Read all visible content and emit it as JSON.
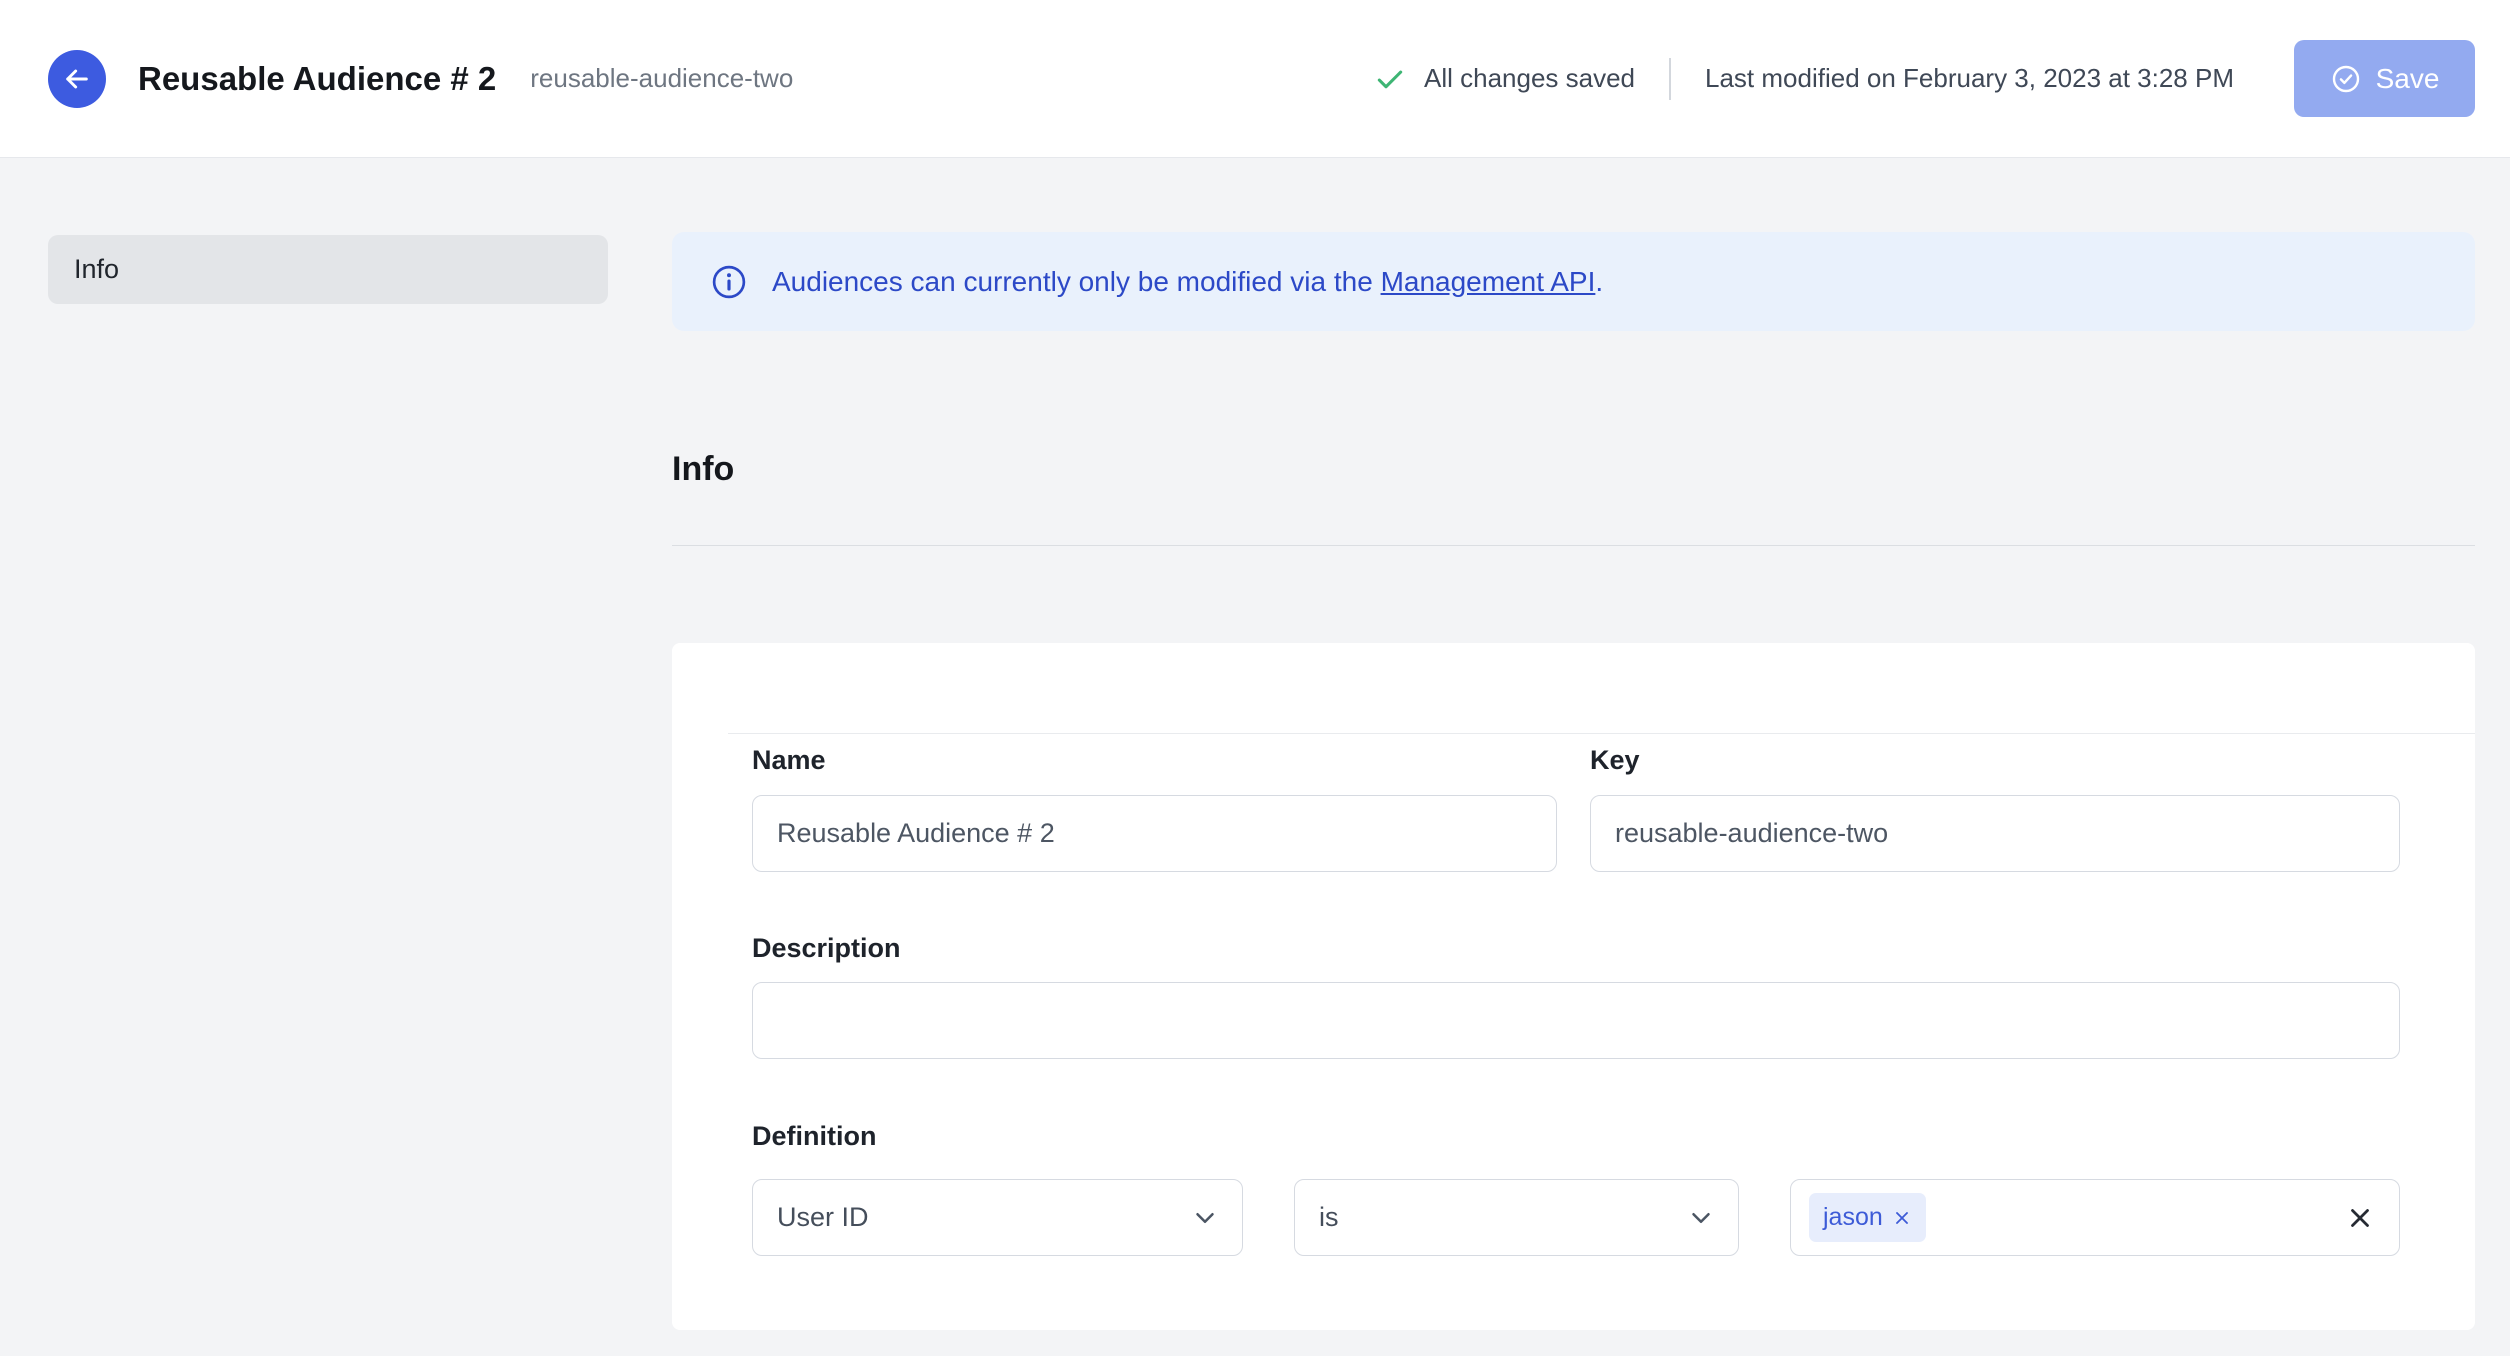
{
  "header": {
    "back_label": "Back",
    "title": "Reusable Audience # 2",
    "slug": "reusable-audience-two",
    "status_text": "All changes saved",
    "last_modified": "Last modified on February 3, 2023 at 3:28 PM",
    "save_label": "Save"
  },
  "sidebar": {
    "items": [
      {
        "label": "Info",
        "active": true
      }
    ]
  },
  "banner": {
    "text_before_link": "Audiences can currently only be modified via the ",
    "link_text": "Management API",
    "text_after_link": "."
  },
  "section": {
    "heading": "Info"
  },
  "form": {
    "name": {
      "label": "Name",
      "value": "Reusable Audience # 2"
    },
    "key": {
      "label": "Key",
      "value": "reusable-audience-two"
    },
    "description": {
      "label": "Description",
      "value": ""
    },
    "definition": {
      "label": "Definition",
      "trait": {
        "selected": "User ID"
      },
      "operator": {
        "selected": "is"
      },
      "tags": [
        "jason"
      ]
    }
  },
  "icons": {
    "back": "arrow-left-icon",
    "saved_status": "check-icon",
    "save_button": "check-circle-icon",
    "banner": "info-circle-icon",
    "selects": "chevron-down-icon",
    "chip_remove": "x-icon",
    "tag_clear": "x-icon"
  },
  "colors": {
    "accent_blue": "#3d5be0",
    "save_button_bg": "#93aaf0",
    "banner_bg": "#e9f1fc",
    "banner_text": "#2c49c7",
    "success_green": "#3eb574",
    "chip_bg": "#e7edfc",
    "body_bg": "#f3f4f6"
  }
}
